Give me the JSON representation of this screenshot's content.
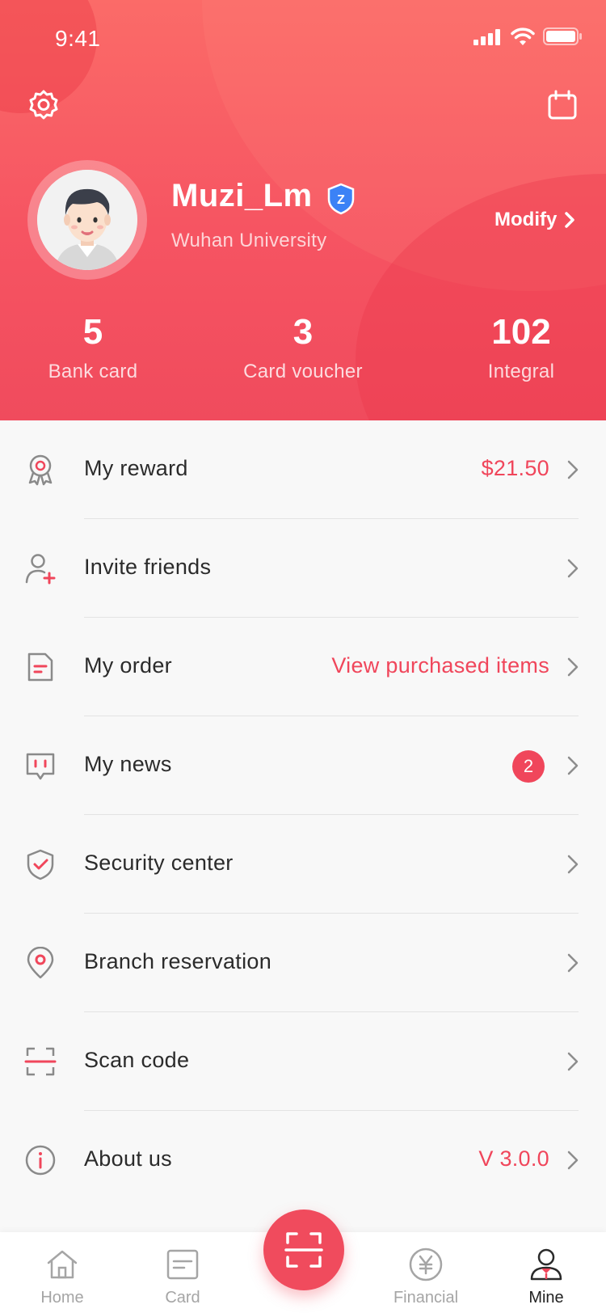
{
  "status_bar": {
    "time": "9:41"
  },
  "profile": {
    "name": "Muzi_Lm",
    "badge_letter": "Z",
    "school": "Wuhan University",
    "modify_label": "Modify"
  },
  "stats": [
    {
      "value": "5",
      "label": "Bank card"
    },
    {
      "value": "3",
      "label": "Card voucher"
    },
    {
      "value": "102",
      "label": "Integral"
    }
  ],
  "menu": [
    {
      "label": "My reward",
      "value": "$21.50",
      "icon": "reward-medal-icon"
    },
    {
      "label": "Invite friends",
      "value": "",
      "icon": "invite-user-icon"
    },
    {
      "label": "My order",
      "value": "View purchased items",
      "icon": "order-document-icon"
    },
    {
      "label": "My news",
      "badge": "2",
      "icon": "message-icon"
    },
    {
      "label": "Security center",
      "value": "",
      "icon": "shield-check-icon"
    },
    {
      "label": "Branch reservation",
      "value": "",
      "icon": "location-pin-icon"
    },
    {
      "label": "Scan code",
      "value": "",
      "icon": "scan-icon"
    },
    {
      "label": "About us",
      "value": "V 3.0.0",
      "icon": "info-icon"
    }
  ],
  "tabs": [
    {
      "label": "Home",
      "icon": "home-icon"
    },
    {
      "label": "Card",
      "icon": "card-icon"
    },
    {
      "label": "Financial",
      "icon": "yen-coin-icon"
    },
    {
      "label": "Mine",
      "icon": "person-icon",
      "active": true
    }
  ],
  "colors": {
    "brand": "#f04b5d",
    "header_top": "#fb6b68",
    "text": "#2b2b2b",
    "muted": "#a5a5a5",
    "verify_badge": "#3b82f6"
  }
}
